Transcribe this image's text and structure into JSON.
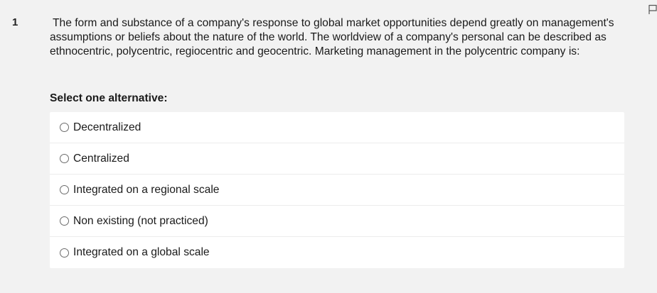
{
  "question": {
    "number": "1",
    "text": "The form and substance of a company's response to global market opportunities depend greatly on management's assumptions or beliefs about the nature of the world. The worldview of a company's personal can be described as ethnocentric, polycentric, regiocentric and geocentric. Marketing management in the polycentric company is:"
  },
  "prompt": "Select one alternative:",
  "options": [
    {
      "label": "Decentralized",
      "selected": false
    },
    {
      "label": "Centralized",
      "selected": false
    },
    {
      "label": "Integrated on a regional scale",
      "selected": false
    },
    {
      "label": "Non existing (not practiced)",
      "selected": false
    },
    {
      "label": "Integrated on a global scale",
      "selected": false
    }
  ],
  "icons": {
    "flag": "flag-icon"
  }
}
